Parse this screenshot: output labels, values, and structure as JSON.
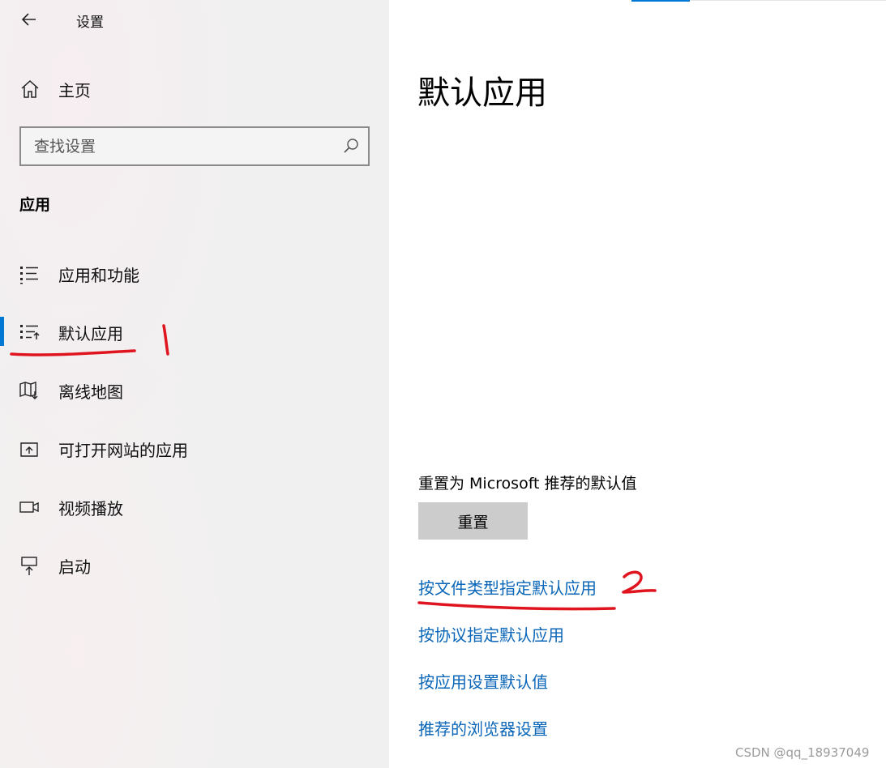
{
  "titlebar": {
    "title": "设置"
  },
  "sidebar": {
    "home_label": "主页",
    "search_placeholder": "查找设置",
    "section_header": "应用",
    "items": [
      {
        "label": "应用和功能",
        "icon": "apps-list-icon"
      },
      {
        "label": "默认应用",
        "icon": "default-apps-icon",
        "selected": true
      },
      {
        "label": "离线地图",
        "icon": "map-icon"
      },
      {
        "label": "可打开网站的应用",
        "icon": "open-website-icon"
      },
      {
        "label": "视频播放",
        "icon": "video-icon"
      },
      {
        "label": "启动",
        "icon": "startup-icon"
      }
    ]
  },
  "main": {
    "title": "默认应用",
    "reset_description": "重置为 Microsoft 推荐的默认值",
    "reset_button": "重置",
    "links": [
      "按文件类型指定默认应用",
      "按协议指定默认应用",
      "按应用设置默认值",
      "推荐的浏览器设置"
    ]
  },
  "annotations": {
    "mark1": "1",
    "mark2": "2"
  },
  "watermark": "CSDN @qq_18937049",
  "colors": {
    "accent": "#0078d4",
    "link": "#0a66b8",
    "annotation": "#e0141e",
    "button": "#cccccc"
  }
}
